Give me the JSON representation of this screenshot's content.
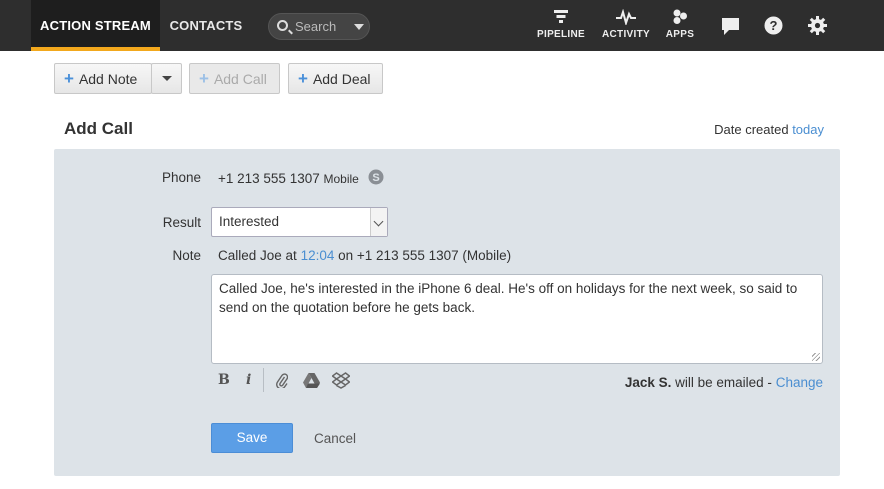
{
  "nav": {
    "tabs": [
      {
        "label": "ACTION STREAM",
        "active": true
      },
      {
        "label": "CONTACTS",
        "active": false
      }
    ],
    "search_placeholder": "Search",
    "icons": [
      {
        "label": "PIPELINE",
        "icon": "pipeline-icon"
      },
      {
        "label": "ACTIVITY",
        "icon": "activity-icon"
      },
      {
        "label": "APPS",
        "icon": "apps-icon"
      }
    ],
    "utility_icons": [
      "chat-icon",
      "help-icon",
      "gear-icon"
    ]
  },
  "toolbar": {
    "add_note": "Add Note",
    "add_call": "Add Call",
    "add_deal": "Add Deal"
  },
  "form": {
    "title": "Add Call",
    "date_created_label": "Date created",
    "date_created_value": "today",
    "phone_label": "Phone",
    "phone_number": "+1 213 555 1307",
    "phone_type": "Mobile",
    "result_label": "Result",
    "result_value": "Interested",
    "note_label": "Note",
    "note_prefix": "Called Joe at",
    "note_time": "12:04",
    "note_suffix": "on +1 213 555 1307 (Mobile)",
    "note_text": "Called Joe, he's interested in the iPhone 6 deal. He's off on holidays for the next week, so said to send on the quotation before he gets back.",
    "format_buttons": {
      "bold": "B",
      "italic": "i"
    },
    "email_user": "Jack S.",
    "email_text": "will be emailed -",
    "email_change": "Change",
    "save_label": "Save",
    "cancel_label": "Cancel"
  },
  "colors": {
    "accent_tab": "#f2a81d",
    "link": "#4a8ed1",
    "save_button": "#5b9ee6",
    "panel_bg": "#dde3e8"
  }
}
